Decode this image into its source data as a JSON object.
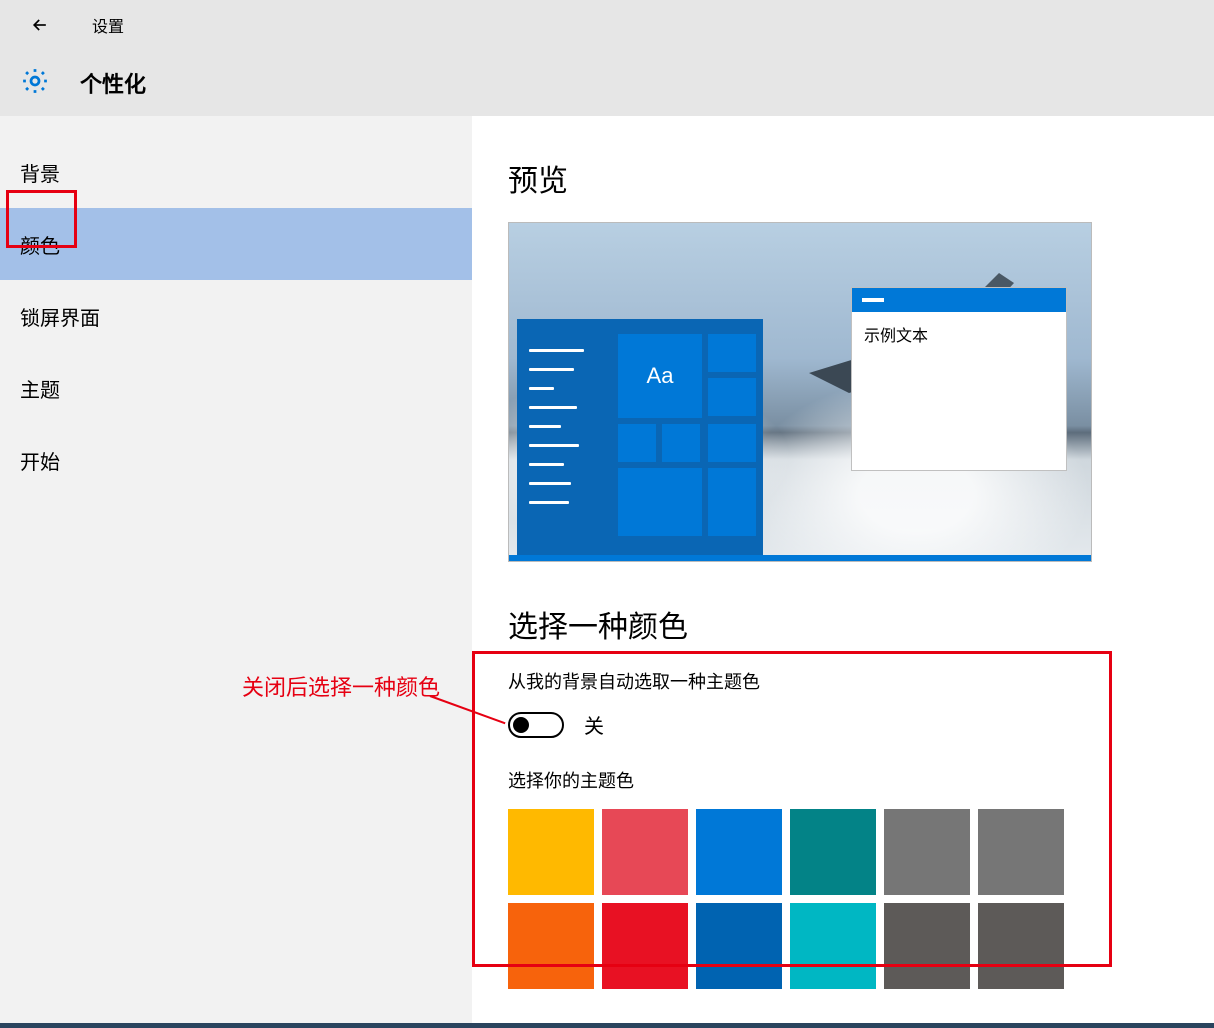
{
  "titlebar": {
    "title": "设置"
  },
  "header": {
    "title": "个性化"
  },
  "sidebar": {
    "items": [
      {
        "label": "背景"
      },
      {
        "label": "颜色"
      },
      {
        "label": "锁屏界面"
      },
      {
        "label": "主题"
      },
      {
        "label": "开始"
      }
    ],
    "selected_index": 1
  },
  "main": {
    "preview_title": "预览",
    "preview_window_text": "示例文本",
    "preview_tile_text": "Aa",
    "choose_color_title": "选择一种颜色",
    "auto_pick_label": "从我的背景自动选取一种主题色",
    "toggle_state_label": "关",
    "choose_accent_label": "选择你的主题色",
    "swatches_row1": [
      "#ffb900",
      "#e74856",
      "#0078d7",
      "#038387",
      "#767676",
      "#767676"
    ],
    "swatches_row2": [
      "#f7630c",
      "#e81123",
      "#0063b1",
      "#00b7c3",
      "#5d5a58",
      "#5d5a58"
    ]
  },
  "annotation": {
    "text": "关闭后选择一种颜色"
  }
}
